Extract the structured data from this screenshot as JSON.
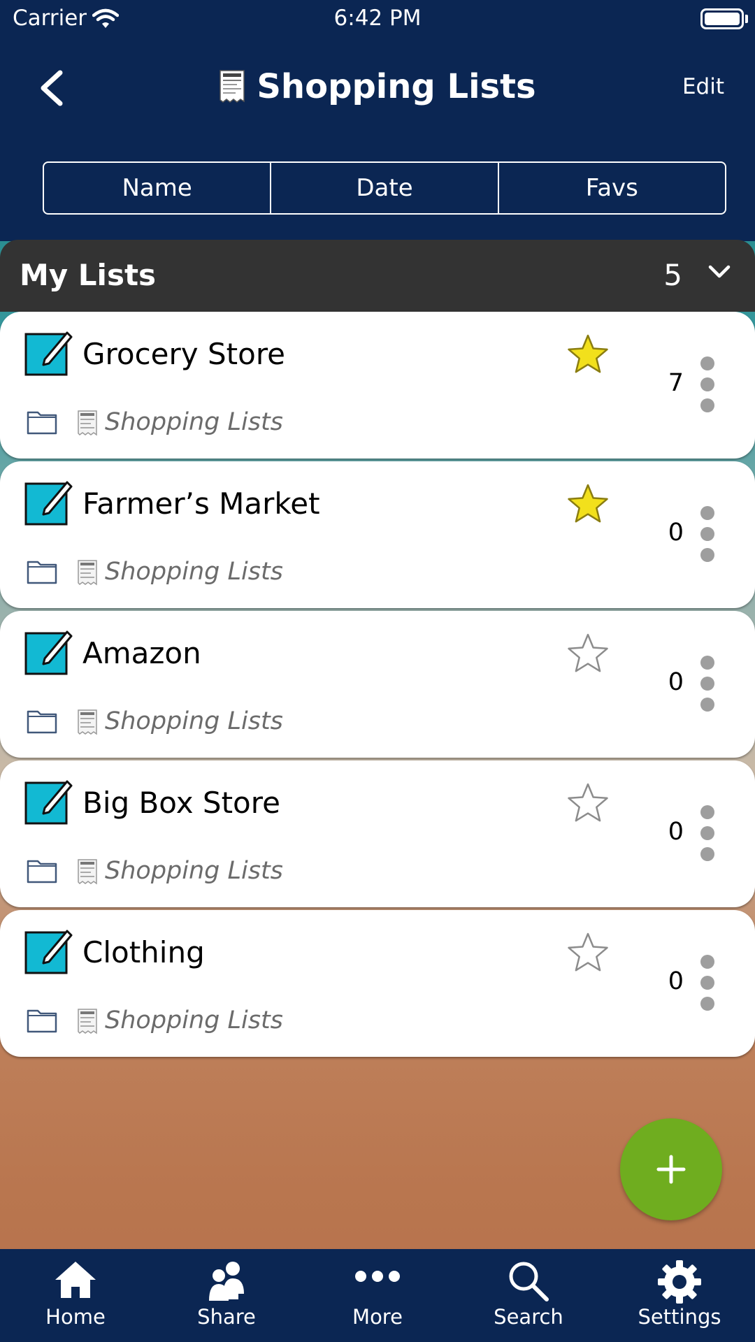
{
  "status_bar": {
    "carrier": "Carrier",
    "time": "6:42 PM"
  },
  "header": {
    "title": "Shopping Lists",
    "edit_label": "Edit",
    "back_icon": "chevron-left-icon",
    "title_icon": "receipt-icon"
  },
  "sort_tabs": [
    {
      "label": "Name"
    },
    {
      "label": "Date"
    },
    {
      "label": "Favs"
    }
  ],
  "section": {
    "title": "My Lists",
    "count": "5"
  },
  "lists": [
    {
      "name": "Grocery Store",
      "folder": "Shopping Lists",
      "favorite": true,
      "count": "7"
    },
    {
      "name": "Farmer’s Market",
      "folder": "Shopping Lists",
      "favorite": true,
      "count": "0"
    },
    {
      "name": "Amazon",
      "folder": "Shopping Lists",
      "favorite": false,
      "count": "0"
    },
    {
      "name": "Big Box Store",
      "folder": "Shopping Lists",
      "favorite": false,
      "count": "0"
    },
    {
      "name": "Clothing",
      "folder": "Shopping Lists",
      "favorite": false,
      "count": "0"
    }
  ],
  "colors": {
    "nav": "#0b2653",
    "section": "#333333",
    "fab": "#6fad1f",
    "star_fav": "#f2e01c",
    "list_icon": "#12b9d3"
  },
  "tab_bar": [
    {
      "label": "Home",
      "icon": "home-icon"
    },
    {
      "label": "Share",
      "icon": "share-people-icon"
    },
    {
      "label": "More",
      "icon": "more-dots-icon"
    },
    {
      "label": "Search",
      "icon": "search-icon"
    },
    {
      "label": "Settings",
      "icon": "gear-icon"
    }
  ]
}
